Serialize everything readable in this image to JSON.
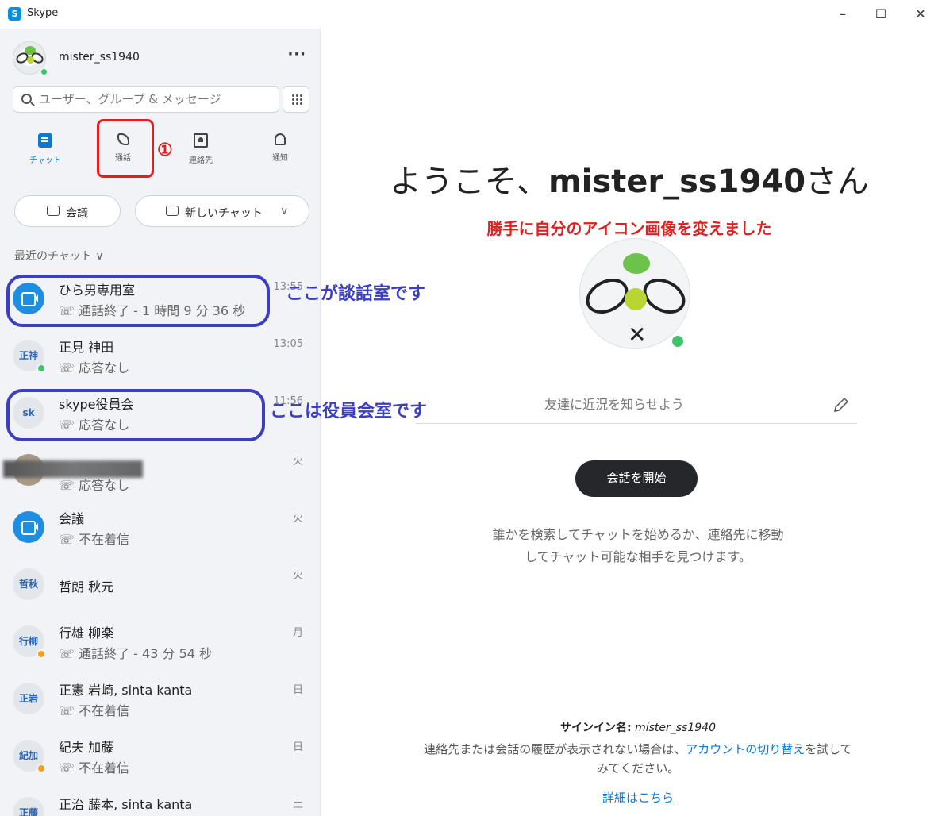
{
  "window": {
    "title": "Skype",
    "minimize": "–",
    "maximize": "☐",
    "close": "✕"
  },
  "profile": {
    "name": "mister_ss1940",
    "more": "···"
  },
  "search": {
    "placeholder": "ユーザー、グループ & メッセージ"
  },
  "nav": {
    "chat": "チャット",
    "calls": "通話",
    "contacts": "連絡先",
    "notifications": "通知"
  },
  "annotation_step": "①",
  "buttons": {
    "meeting": "会議",
    "new_chat": "新しいチャット"
  },
  "recent_label": "最近のチャット",
  "chats": [
    {
      "title": "ひら男専用室",
      "sub": "通話終了 - 1 時間 9 分 36 秒",
      "time": "13:55",
      "avatar": "",
      "type": "video"
    },
    {
      "title": "正見 神田",
      "sub": "応答なし",
      "time": "13:05",
      "avatar": "正神",
      "status": "#3ec46d"
    },
    {
      "title": "skype役員会",
      "sub": "応答なし",
      "time": "11:56",
      "avatar": "sk"
    },
    {
      "title": "",
      "sub": "応答なし",
      "time": "火",
      "avatar": ""
    },
    {
      "title": "会議",
      "sub": "不在着信",
      "time": "火",
      "avatar": "",
      "type": "video"
    },
    {
      "title": "哲朗 秋元",
      "sub": "",
      "time": "火",
      "avatar": "哲秋"
    },
    {
      "title": "行雄 柳楽",
      "sub": "通話終了 - 43 分 54 秒",
      "time": "月",
      "avatar": "行柳",
      "status": "#f0a020"
    },
    {
      "title": "正憲 岩崎, sinta kanta",
      "sub": "不在着信",
      "time": "日",
      "avatar": "正岩"
    },
    {
      "title": "紀夫 加藤",
      "sub": "不在着信",
      "time": "日",
      "avatar": "紀加",
      "status": "#f0a020"
    },
    {
      "title": "正治 藤本, sinta kanta",
      "sub": "",
      "time": "土",
      "avatar": "正藤"
    }
  ],
  "annotations": {
    "room1": "ここが談話室です",
    "room2": "ここは役員会室です",
    "icon_note": "勝手に自分のアイコン画像を変えました"
  },
  "main": {
    "welcome_prefix": "ようこそ、",
    "welcome_name": "mister_ss1940",
    "welcome_suffix": "さん",
    "mood_placeholder": "友達に近況を知らせよう",
    "start_button": "会話を開始",
    "hint_line1": "誰かを検索してチャットを始めるか、連絡先に移動",
    "hint_line2": "してチャット可能な相手を見つけます。",
    "signin_label": "サインイン名:",
    "signin_value": "mister_ss1940",
    "footer_pre": "連絡先または会話の履歴が表示されない場合は、",
    "footer_link": "アカウントの切り替え",
    "footer_post": "を試して",
    "footer_line2": "みてください。",
    "detail_link": "詳細はこちら"
  },
  "colors": {
    "accent": "#0a78d4",
    "annotation_red": "#e02020",
    "annotation_blue": "#3b3fbf",
    "online": "#3ec46d"
  }
}
